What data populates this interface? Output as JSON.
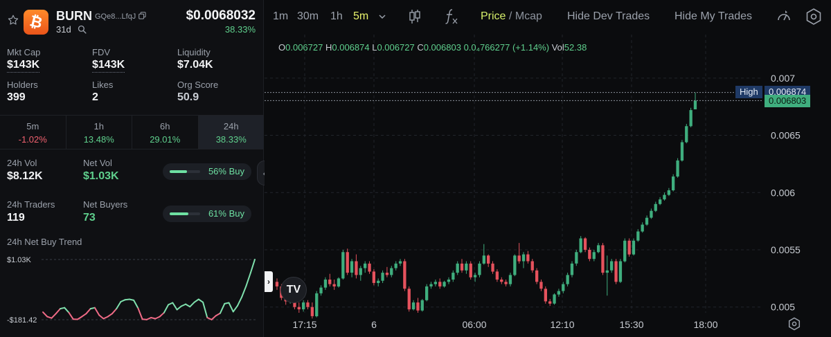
{
  "token": {
    "ticker": "BURN",
    "address": "GQe8...LfqJ",
    "age": "31d",
    "price": "$0.0068032",
    "change": "38.33%"
  },
  "stats": [
    {
      "label": "Mkt Cap",
      "value": "$143K"
    },
    {
      "label": "FDV",
      "value": "$143K"
    },
    {
      "label": "Liquidity",
      "value": "$7.04K"
    },
    {
      "label": "Holders",
      "value": "399"
    },
    {
      "label": "Likes",
      "value": "2"
    },
    {
      "label": "Org Score",
      "value": "50.9"
    }
  ],
  "periods": [
    {
      "label": "5m",
      "value": "-1.02%"
    },
    {
      "label": "1h",
      "value": "13.48%"
    },
    {
      "label": "6h",
      "value": "29.01%"
    },
    {
      "label": "24h",
      "value": "38.33%"
    }
  ],
  "flow": {
    "vol_label": "24h Vol",
    "vol_value": "$8.12K",
    "netvol_label": "Net Vol",
    "netvol_value": "$1.03K",
    "vol_buy_pct": 56,
    "vol_buy_text": "56% Buy",
    "traders_label": "24h Traders",
    "traders_value": "119",
    "netbuyers_label": "Net Buyers",
    "netbuyers_value": "73",
    "traders_buy_pct": 61,
    "traders_buy_text": "61% Buy"
  },
  "trend": {
    "title": "24h Net Buy Trend",
    "max_label": "$1.03K",
    "min_label": "-$181.42",
    "max": 1030,
    "min": -181.42,
    "values": [
      -30,
      -120,
      -150,
      -60,
      40,
      60,
      -40,
      -170,
      -175,
      -120,
      -60,
      40,
      60,
      -90,
      -160,
      -120,
      -60,
      40,
      180,
      220,
      230,
      210,
      50,
      -170,
      -180,
      -140,
      -160,
      -120,
      -40,
      120,
      160,
      20,
      90,
      130,
      80,
      170,
      230,
      170,
      -140,
      -180,
      -100,
      -50,
      140,
      160,
      -20,
      100,
      280,
      500,
      760,
      1030
    ]
  },
  "chart_toolbar": {
    "tf_1m": "1m",
    "tf_30m": "30m",
    "tf_1h": "1h",
    "tf_5m": "5m",
    "price": "Price",
    "sep": "/",
    "mcap": "Mcap",
    "hide_dev": "Hide Dev Trades",
    "hide_my": "Hide My Trades"
  },
  "ohlc": {
    "o_label": "O",
    "o": "0.006727",
    "h_label": "H",
    "h": "0.006874",
    "l_label": "L",
    "l": "0.006727",
    "c_label": "C",
    "c": "0.006803",
    "chg": "0.0₄766277 (+1.14%)",
    "vol_label": "Vol",
    "vol": "52.38"
  },
  "chart_data": {
    "type": "candlestick",
    "y_ticks": [
      "0.007",
      "0.0065",
      "0.006",
      "0.0055",
      "0.005"
    ],
    "y_tick_values": [
      0.007,
      0.0065,
      0.006,
      0.0055,
      0.005
    ],
    "x_ticks": [
      "17:15",
      "6",
      "06:00",
      "12:10",
      "15:30",
      "18:00"
    ],
    "high_tag_label": "High",
    "high_value": "0.006874",
    "last_value": "0.006803",
    "colors": {
      "up": "#3fae7e",
      "down": "#e5525d"
    },
    "candles": [
      [
        0.00522,
        0.00525,
        0.00515,
        0.00518
      ],
      [
        0.00518,
        0.0052,
        0.00506,
        0.00508
      ],
      [
        0.00508,
        0.00512,
        0.00502,
        0.00505
      ],
      [
        0.00505,
        0.00513,
        0.00503,
        0.00511
      ],
      [
        0.00511,
        0.00515,
        0.00498,
        0.005
      ],
      [
        0.005,
        0.00504,
        0.00495,
        0.00498
      ],
      [
        0.00498,
        0.00506,
        0.00496,
        0.00504
      ],
      [
        0.00504,
        0.00506,
        0.00498,
        0.005
      ],
      [
        0.005,
        0.00504,
        0.0049,
        0.00492
      ],
      [
        0.00492,
        0.00514,
        0.00491,
        0.00512
      ],
      [
        0.00512,
        0.00519,
        0.0051,
        0.00517
      ],
      [
        0.00517,
        0.00526,
        0.00515,
        0.00524
      ],
      [
        0.00524,
        0.00529,
        0.00518,
        0.0052
      ],
      [
        0.0052,
        0.00524,
        0.00515,
        0.00518
      ],
      [
        0.00518,
        0.00526,
        0.00517,
        0.00525
      ],
      [
        0.00525,
        0.0055,
        0.00524,
        0.00548
      ],
      [
        0.00548,
        0.00551,
        0.00528,
        0.0053
      ],
      [
        0.0053,
        0.00542,
        0.00526,
        0.0054
      ],
      [
        0.0054,
        0.00546,
        0.00525,
        0.00528
      ],
      [
        0.00528,
        0.00536,
        0.00523,
        0.00534
      ],
      [
        0.00534,
        0.0054,
        0.0053,
        0.00538
      ],
      [
        0.00538,
        0.0054,
        0.00529,
        0.00531
      ],
      [
        0.00531,
        0.00533,
        0.00519,
        0.00521
      ],
      [
        0.00521,
        0.00525,
        0.00518,
        0.00523
      ],
      [
        0.00523,
        0.00532,
        0.00521,
        0.0053
      ],
      [
        0.0053,
        0.00535,
        0.00526,
        0.00528
      ],
      [
        0.00528,
        0.00536,
        0.00526,
        0.00534
      ],
      [
        0.00534,
        0.0054,
        0.00532,
        0.00538
      ],
      [
        0.00538,
        0.00542,
        0.00536,
        0.0054
      ],
      [
        0.0054,
        0.00542,
        0.00514,
        0.00516
      ],
      [
        0.00516,
        0.00518,
        0.00496,
        0.00498
      ],
      [
        0.00498,
        0.00506,
        0.00497,
        0.00504
      ],
      [
        0.00504,
        0.00508,
        0.00495,
        0.00497
      ],
      [
        0.00497,
        0.00507,
        0.00496,
        0.00506
      ],
      [
        0.00506,
        0.0052,
        0.00505,
        0.00518
      ],
      [
        0.00518,
        0.00522,
        0.00516,
        0.0052
      ],
      [
        0.0052,
        0.00524,
        0.00518,
        0.00522
      ],
      [
        0.00522,
        0.00525,
        0.00516,
        0.00518
      ],
      [
        0.00518,
        0.00523,
        0.00517,
        0.00522
      ],
      [
        0.00522,
        0.00526,
        0.0052,
        0.00524
      ],
      [
        0.00524,
        0.00532,
        0.00522,
        0.0053
      ],
      [
        0.0053,
        0.0054,
        0.00528,
        0.00538
      ],
      [
        0.00538,
        0.00542,
        0.0053,
        0.00532
      ],
      [
        0.00532,
        0.0054,
        0.00529,
        0.00538
      ],
      [
        0.00538,
        0.0054,
        0.00524,
        0.00526
      ],
      [
        0.00526,
        0.0053,
        0.00522,
        0.00528
      ],
      [
        0.00528,
        0.0054,
        0.00526,
        0.00538
      ],
      [
        0.00538,
        0.00555,
        0.00537,
        0.00545
      ],
      [
        0.00545,
        0.00546,
        0.00535,
        0.00538
      ],
      [
        0.00538,
        0.0054,
        0.00529,
        0.00531
      ],
      [
        0.00531,
        0.00533,
        0.00522,
        0.00524
      ],
      [
        0.00524,
        0.00526,
        0.0052,
        0.00522
      ],
      [
        0.00522,
        0.00524,
        0.00518,
        0.0052
      ],
      [
        0.0052,
        0.0053,
        0.00518,
        0.00528
      ],
      [
        0.00528,
        0.00546,
        0.00527,
        0.00545
      ],
      [
        0.00545,
        0.00556,
        0.00538,
        0.0054
      ],
      [
        0.0054,
        0.00548,
        0.00534,
        0.00546
      ],
      [
        0.00546,
        0.00549,
        0.00538,
        0.0054
      ],
      [
        0.0054,
        0.00542,
        0.0053,
        0.00532
      ],
      [
        0.00532,
        0.00534,
        0.0052,
        0.00522
      ],
      [
        0.00522,
        0.00524,
        0.00514,
        0.00516
      ],
      [
        0.00516,
        0.00518,
        0.00503,
        0.00505
      ],
      [
        0.00505,
        0.00507,
        0.00501,
        0.00503
      ],
      [
        0.00503,
        0.00512,
        0.00502,
        0.00511
      ],
      [
        0.00511,
        0.00516,
        0.00509,
        0.00514
      ],
      [
        0.00514,
        0.00522,
        0.00512,
        0.0052
      ],
      [
        0.0052,
        0.0053,
        0.00518,
        0.00528
      ],
      [
        0.00528,
        0.0054,
        0.00526,
        0.00538
      ],
      [
        0.00538,
        0.0055,
        0.00536,
        0.00548
      ],
      [
        0.00548,
        0.00562,
        0.00547,
        0.0056
      ],
      [
        0.0056,
        0.00561,
        0.00548,
        0.0055
      ],
      [
        0.0055,
        0.00552,
        0.0054,
        0.00542
      ],
      [
        0.00542,
        0.0055,
        0.0054,
        0.00548
      ],
      [
        0.00548,
        0.00556,
        0.00547,
        0.00554
      ],
      [
        0.00554,
        0.00556,
        0.00528,
        0.0053
      ],
      [
        0.0053,
        0.00545,
        0.0051,
        0.00532
      ],
      [
        0.00532,
        0.00542,
        0.0053,
        0.0054
      ],
      [
        0.0054,
        0.00542,
        0.0052,
        0.00522
      ],
      [
        0.00522,
        0.00542,
        0.00521,
        0.0054
      ],
      [
        0.0054,
        0.0056,
        0.00539,
        0.00558
      ],
      [
        0.00558,
        0.0056,
        0.00544,
        0.00546
      ],
      [
        0.00546,
        0.0056,
        0.00545,
        0.00558
      ],
      [
        0.00558,
        0.00568,
        0.00557,
        0.00566
      ],
      [
        0.00566,
        0.00574,
        0.00565,
        0.00572
      ],
      [
        0.00572,
        0.0058,
        0.00571,
        0.00578
      ],
      [
        0.00578,
        0.00586,
        0.00577,
        0.00584
      ],
      [
        0.00584,
        0.00592,
        0.00583,
        0.0059
      ],
      [
        0.0059,
        0.00596,
        0.00589,
        0.00594
      ],
      [
        0.00594,
        0.006,
        0.00593,
        0.00598
      ],
      [
        0.00598,
        0.00604,
        0.00597,
        0.00602
      ],
      [
        0.00602,
        0.00616,
        0.00601,
        0.00614
      ],
      [
        0.00614,
        0.0063,
        0.00613,
        0.00628
      ],
      [
        0.00628,
        0.00646,
        0.00627,
        0.00644
      ],
      [
        0.00644,
        0.0066,
        0.00643,
        0.00658
      ],
      [
        0.00658,
        0.00674,
        0.00657,
        0.00672
      ],
      [
        0.006727,
        0.006874,
        0.006727,
        0.006803
      ]
    ]
  }
}
